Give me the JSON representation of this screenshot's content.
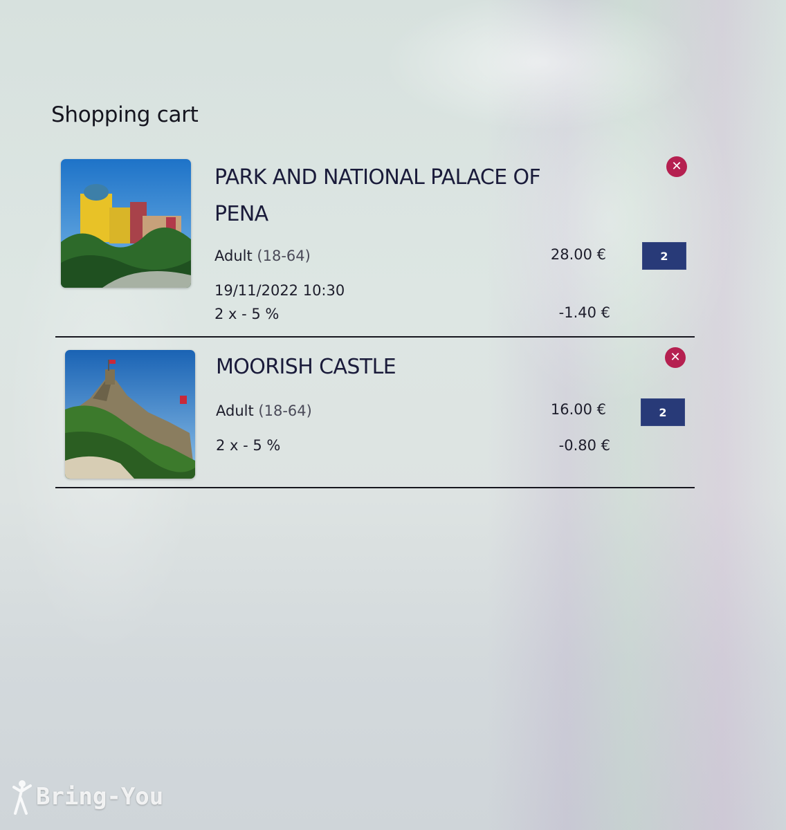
{
  "page": {
    "title": "Shopping cart"
  },
  "cart": {
    "items": [
      {
        "name": "PARK AND NATIONAL PALACE OF PENA",
        "ticket_type": "Adult",
        "age_range": "(18-64)",
        "price": "28.00 €",
        "quantity": "2",
        "date": "19/11/2022 10:30",
        "discount": "2 x - 5 %",
        "discount_amount": "-1.40 €",
        "remove_icon": "close-circle-icon"
      },
      {
        "name": "MOORISH CASTLE",
        "ticket_type": "Adult",
        "age_range": "(18-64)",
        "price": "16.00 €",
        "quantity": "2",
        "discount": "2 x - 5 %",
        "discount_amount": "-0.80 €",
        "remove_icon": "close-circle-icon"
      }
    ]
  },
  "watermark": {
    "text": "Bring-You"
  },
  "colors": {
    "quantity_bg": "#283a78",
    "remove_bg": "#b52050",
    "title_text": "#1a1b3a"
  }
}
